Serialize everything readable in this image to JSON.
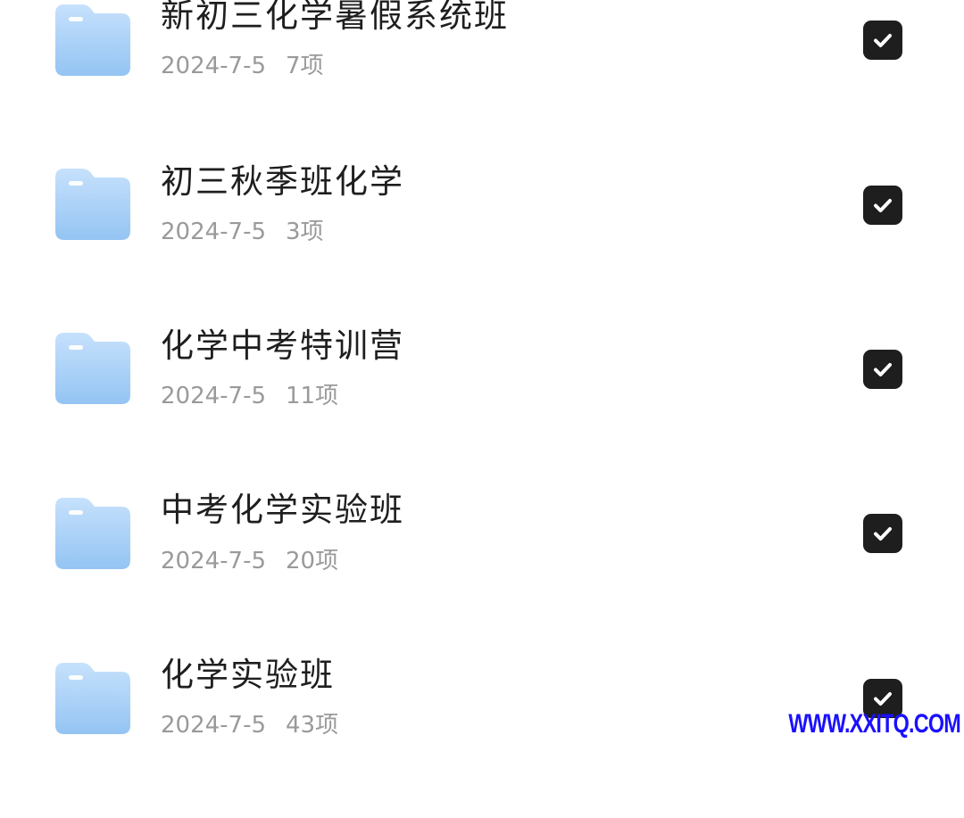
{
  "folders": [
    {
      "name": "新初三化学暑假系统班",
      "date": "2024-7-5",
      "count": "7项",
      "selected": true
    },
    {
      "name": "初三秋季班化学",
      "date": "2024-7-5",
      "count": "3项",
      "selected": true
    },
    {
      "name": "化学中考特训营",
      "date": "2024-7-5",
      "count": "11项",
      "selected": true
    },
    {
      "name": "中考化学实验班",
      "date": "2024-7-5",
      "count": "20项",
      "selected": true
    },
    {
      "name": "化学实验班",
      "date": "2024-7-5",
      "count": "43项",
      "selected": true
    }
  ],
  "icons": {
    "folder": "folder-icon",
    "check": "checkmark-icon"
  },
  "colors": {
    "folder_light": "#c3dffc",
    "folder_dark": "#93c4f3",
    "checkbox": "#1e1e1e",
    "watermark": "#1a10ff"
  },
  "watermark": "WWW.XXITQ.COM"
}
